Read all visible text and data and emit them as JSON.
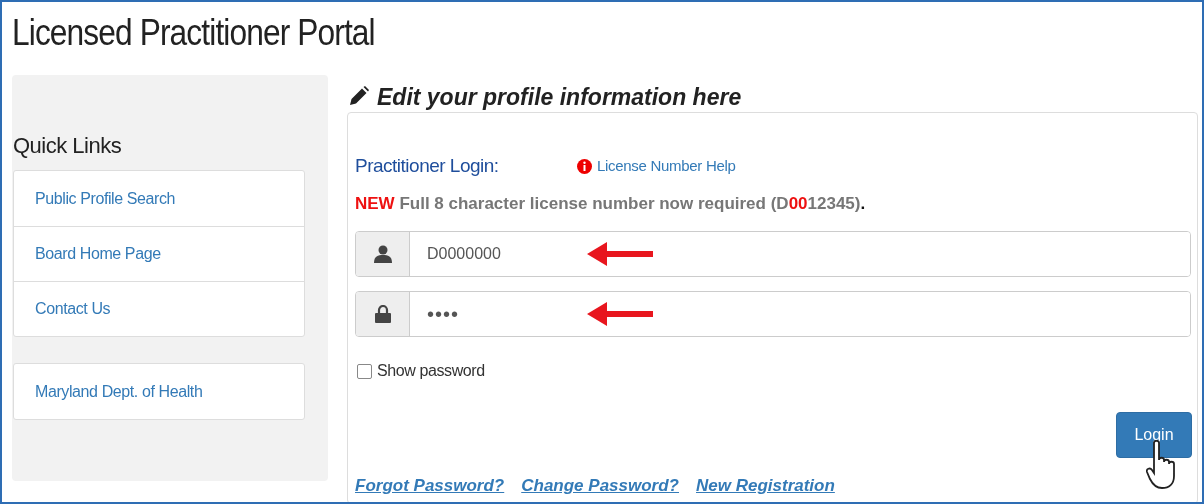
{
  "title": "Licensed Practitioner Portal",
  "sidebar": {
    "heading": "Quick Links",
    "groups": [
      [
        "Public Profile Search",
        "Board Home Page",
        "Contact Us"
      ],
      [
        "Maryland Dept. of Health"
      ]
    ]
  },
  "panel": {
    "heading": "Edit your profile information here",
    "login_label": "Practitioner Login:",
    "help_link": "License Number Help",
    "notice": [
      {
        "text": "NEW",
        "kind": "highlight"
      },
      {
        "text": " Full 8 character license number now required (D",
        "kind": "normal"
      },
      {
        "text": "00",
        "kind": "highlight"
      },
      {
        "text": "12345)",
        "kind": "normal"
      },
      {
        "text": ".",
        "kind": "end"
      }
    ],
    "fields": [
      {
        "kind": "user",
        "value": "D0000000"
      },
      {
        "kind": "password",
        "value": "••••"
      }
    ],
    "show_password": {
      "label": "Show password",
      "checked": false
    },
    "login_button": "Login",
    "links": [
      "Forgot Password?",
      "Change Password?",
      "New Registration"
    ]
  }
}
